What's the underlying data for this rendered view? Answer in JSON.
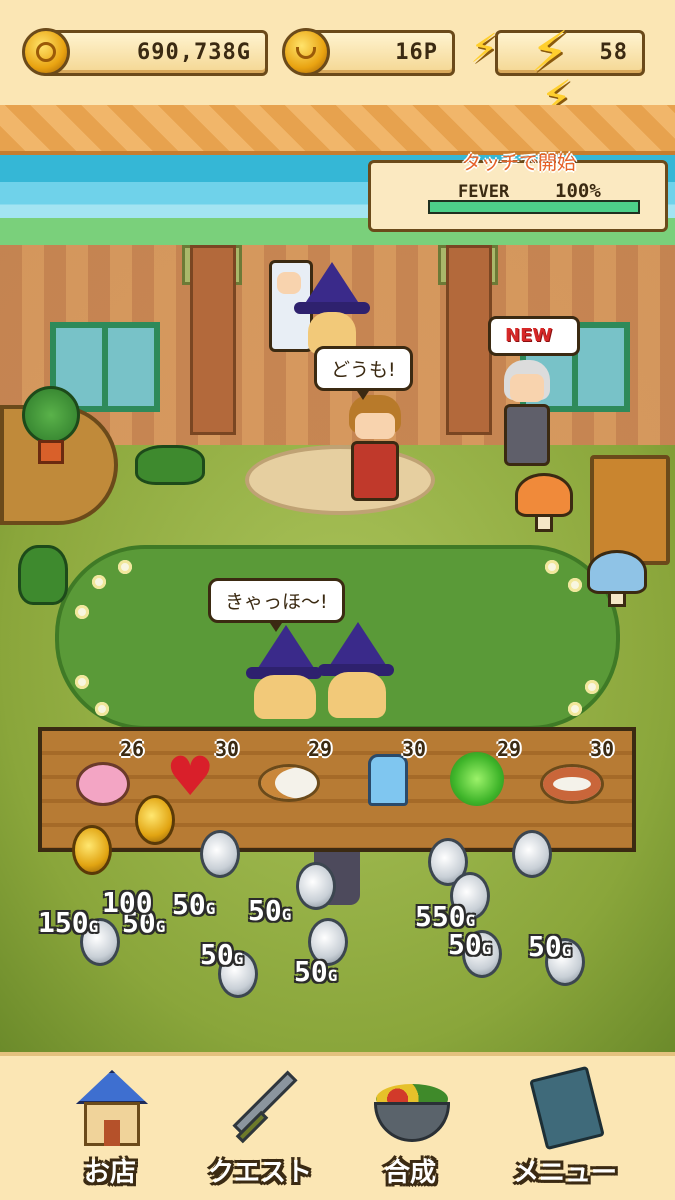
{
  "status_bar": {
    "gold": "690,738G",
    "points": "16P",
    "energy": "58"
  },
  "fever": {
    "prompt": "タッチで開始",
    "label": "FEVER",
    "value": "100%",
    "fill_percent": 100
  },
  "bubbles": {
    "shopkeeper": "どうも!",
    "customers": "きゃっほ〜!",
    "new_badge": "NEW"
  },
  "shelf_items": [
    {
      "name": "donut-icon",
      "count": "26"
    },
    {
      "name": "heart-icon",
      "count": "30"
    },
    {
      "name": "curry-plate-icon",
      "count": "29"
    },
    {
      "name": "blue-dress-icon",
      "count": "30"
    },
    {
      "name": "green-sparkle-icon",
      "count": "29"
    },
    {
      "name": "fish-plate-icon",
      "count": "30"
    }
  ],
  "gold_pops": [
    {
      "text": "150",
      "unit": "G"
    },
    {
      "text": "50",
      "unit": "G"
    },
    {
      "text": "100",
      "unit": ""
    },
    {
      "text": "50",
      "unit": "G"
    },
    {
      "text": "50",
      "unit": "G"
    },
    {
      "text": "50",
      "unit": "G"
    },
    {
      "text": "50",
      "unit": "G"
    },
    {
      "text": "550",
      "unit": "G"
    },
    {
      "text": "50",
      "unit": "G"
    },
    {
      "text": "50",
      "unit": "G"
    }
  ],
  "nav": {
    "shop": "お店",
    "quest": "クエスト",
    "craft": "合成",
    "menu": "メニュー"
  },
  "colors": {
    "panel_bg": "#fbe6b4",
    "outline": "#3b2a12",
    "fever_fill": "#4dd08a",
    "new_badge_text": "#d62828"
  }
}
